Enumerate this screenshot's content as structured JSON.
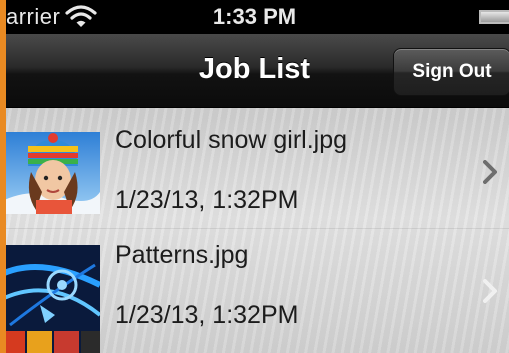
{
  "status_bar": {
    "carrier": "arrier",
    "time": "1:33 PM"
  },
  "nav_bar": {
    "title": "Job List",
    "right_button": "Sign Out"
  },
  "jobs": [
    {
      "name": "Colorful snow girl.jpg",
      "date": "1/23/13, 1:32PM",
      "thumbnail": "girl-in-colorful-knit-hat"
    },
    {
      "name": "Patterns.jpg",
      "date": "1/23/13, 1:32PM",
      "thumbnail": "abstract-blue-patterns"
    }
  ],
  "colors": {
    "frame_accent": "#e98a22",
    "nav_bar": "#1e1e1e",
    "list_background": "#d8d8d8",
    "chevron": "#6e6e6e"
  }
}
